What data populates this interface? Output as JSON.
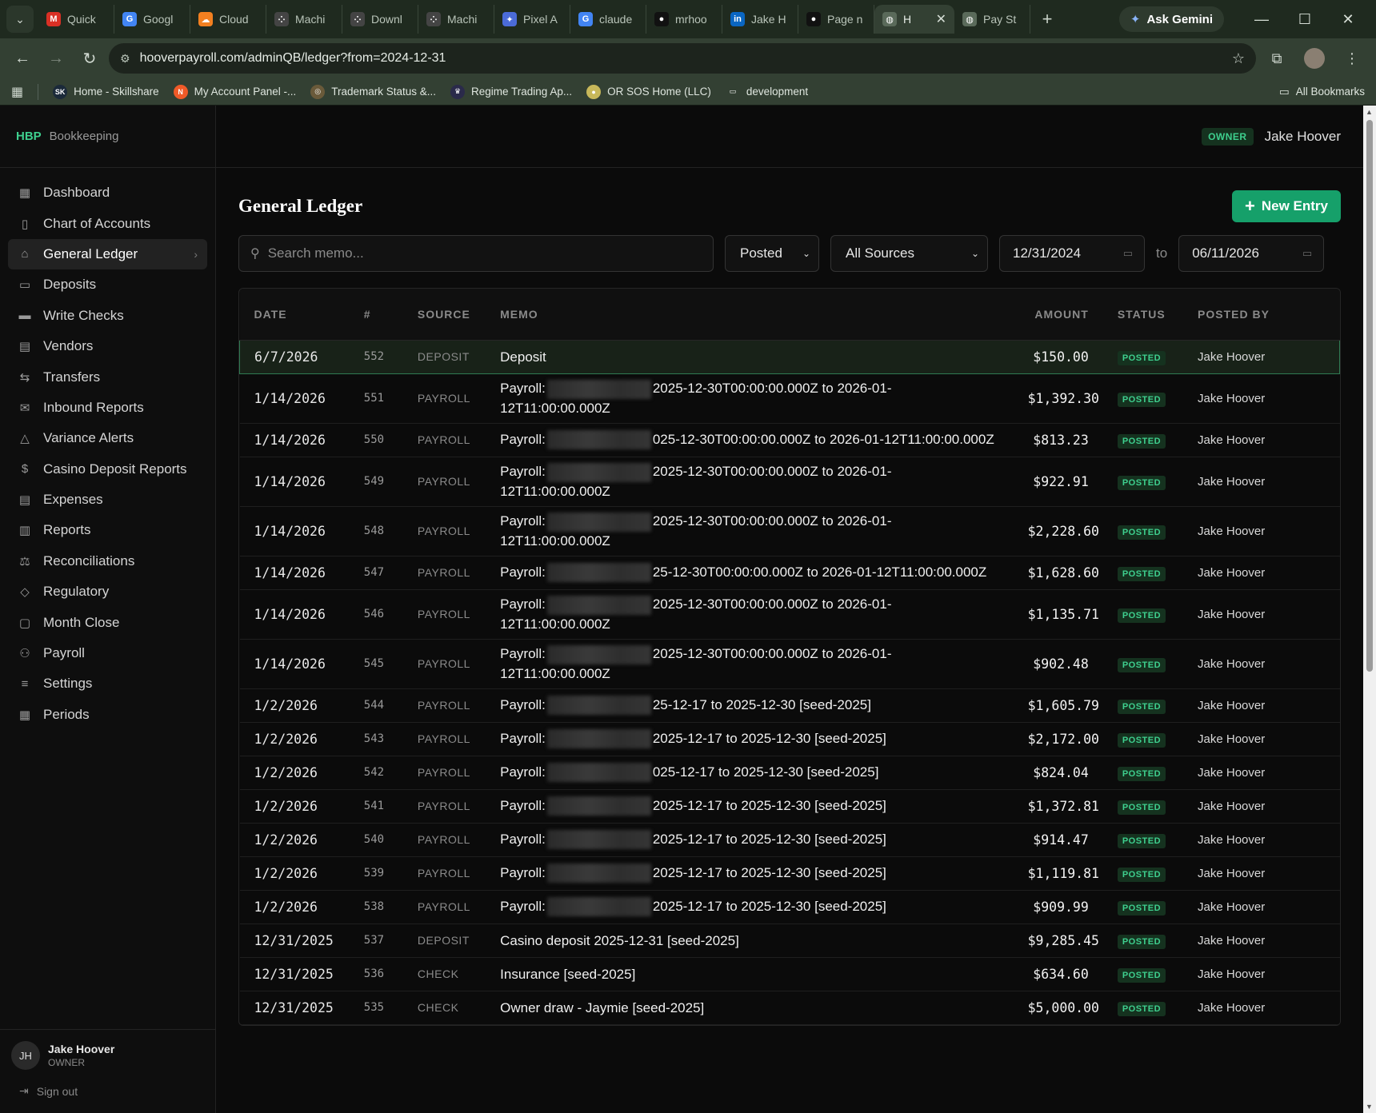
{
  "browser": {
    "tabs": [
      {
        "label": "Quick",
        "icon": "gmail-icon",
        "color": "#d93025",
        "glyph": "M"
      },
      {
        "label": "Googl",
        "icon": "google-icon",
        "color": "#4285f4",
        "glyph": "G"
      },
      {
        "label": "Cloud",
        "icon": "cloudflare-icon",
        "color": "#f38020",
        "glyph": "☁"
      },
      {
        "label": "Machi",
        "icon": "dots-icon",
        "color": "#444444",
        "glyph": "⁘"
      },
      {
        "label": "Downl",
        "icon": "dots-icon",
        "color": "#444444",
        "glyph": "⁘"
      },
      {
        "label": "Machi",
        "icon": "dots-icon",
        "color": "#444444",
        "glyph": "⁘"
      },
      {
        "label": "Pixel A",
        "icon": "gemini-icon",
        "color": "#4b6bd8",
        "glyph": "✦"
      },
      {
        "label": "claude",
        "icon": "google-icon",
        "color": "#4285f4",
        "glyph": "G"
      },
      {
        "label": "mrhoo",
        "icon": "github-icon",
        "color": "#111111",
        "glyph": "●"
      },
      {
        "label": "Jake H",
        "icon": "linkedin-icon",
        "color": "#0a66c2",
        "glyph": "in"
      },
      {
        "label": "Page n",
        "icon": "github-icon",
        "color": "#111111",
        "glyph": "●"
      }
    ],
    "active_tab": {
      "label": "H",
      "icon": "globe-icon"
    },
    "after_tab": {
      "label": "Pay St",
      "icon": "globe-icon"
    },
    "gemini_label": "Ask Gemini",
    "url": "hooverpayroll.com/adminQB/ledger?from=2024-12-31",
    "bookmarks": [
      {
        "label": "Home - Skillshare",
        "glyph": "SK",
        "color": "#1b2a3a"
      },
      {
        "label": "My Account Panel -...",
        "glyph": "N",
        "color": "#f05a28"
      },
      {
        "label": "Trademark Status &...",
        "glyph": "◎",
        "color": "#6a5a3a"
      },
      {
        "label": "Regime Trading Ap...",
        "glyph": "♛",
        "color": "#2a2a4a"
      },
      {
        "label": "OR SOS Home (LLC)",
        "glyph": "●",
        "color": "#c8b85a"
      },
      {
        "label": "development",
        "glyph": "▭",
        "color": "transparent"
      }
    ],
    "all_bookmarks": "All Bookmarks"
  },
  "app": {
    "brand_mark": "HBP",
    "brand_name": "Bookkeeping",
    "nav": [
      {
        "label": "Dashboard",
        "icon": "▦",
        "name": "dashboard"
      },
      {
        "label": "Chart of Accounts",
        "icon": "▯",
        "name": "chart-of-accounts"
      },
      {
        "label": "General Ledger",
        "icon": "⌂",
        "name": "general-ledger",
        "active": true
      },
      {
        "label": "Deposits",
        "icon": "▭",
        "name": "deposits"
      },
      {
        "label": "Write Checks",
        "icon": "▬",
        "name": "write-checks"
      },
      {
        "label": "Vendors",
        "icon": "▤",
        "name": "vendors"
      },
      {
        "label": "Transfers",
        "icon": "⇆",
        "name": "transfers"
      },
      {
        "label": "Inbound Reports",
        "icon": "✉",
        "name": "inbound-reports"
      },
      {
        "label": "Variance Alerts",
        "icon": "△",
        "name": "variance-alerts"
      },
      {
        "label": "Casino Deposit Reports",
        "icon": "$",
        "name": "casino-deposit-reports"
      },
      {
        "label": "Expenses",
        "icon": "▤",
        "name": "expenses"
      },
      {
        "label": "Reports",
        "icon": "▥",
        "name": "reports"
      },
      {
        "label": "Reconciliations",
        "icon": "⚖",
        "name": "reconciliations"
      },
      {
        "label": "Regulatory",
        "icon": "◇",
        "name": "regulatory"
      },
      {
        "label": "Month Close",
        "icon": "▢",
        "name": "month-close"
      },
      {
        "label": "Payroll",
        "icon": "⚇",
        "name": "payroll"
      },
      {
        "label": "Settings",
        "icon": "≡",
        "name": "settings"
      },
      {
        "label": "Periods",
        "icon": "▦",
        "name": "periods"
      }
    ],
    "user": {
      "initials": "JH",
      "name": "Jake Hoover",
      "role": "OWNER"
    },
    "sign_out": "Sign out",
    "topbar": {
      "role_badge": "OWNER",
      "user_name": "Jake Hoover"
    },
    "page_title": "General Ledger",
    "new_entry_label": "New Entry",
    "filters": {
      "search_placeholder": "Search memo...",
      "status_value": "Posted",
      "source_value": "All Sources",
      "from_date": "12/31/2024",
      "to_label": "to",
      "to_date": "06/11/2026"
    },
    "columns": [
      "DATE",
      "#",
      "SOURCE",
      "MEMO",
      "AMOUNT",
      "STATUS",
      "POSTED BY"
    ],
    "rows": [
      {
        "date": "6/7/2026",
        "num": "552",
        "source": "DEPOSIT",
        "memo_a": "Deposit",
        "redacted": false,
        "memo_b": "",
        "amount": "$150.00",
        "status": "POSTED",
        "by": "Jake Hoover",
        "selected": true
      },
      {
        "date": "1/14/2026",
        "num": "551",
        "source": "PAYROLL",
        "memo_a": "Payroll:",
        "redacted": true,
        "memo_b": "2025-12-30T00:00:00.000Z to 2026-01-12T11:00:00.000Z",
        "amount": "$1,392.30",
        "status": "POSTED",
        "by": "Jake Hoover"
      },
      {
        "date": "1/14/2026",
        "num": "550",
        "source": "PAYROLL",
        "memo_a": "Payroll:",
        "redacted": true,
        "memo_b": "025-12-30T00:00:00.000Z to 2026-01-12T11:00:00.000Z",
        "amount": "$813.23",
        "status": "POSTED",
        "by": "Jake Hoover"
      },
      {
        "date": "1/14/2026",
        "num": "549",
        "source": "PAYROLL",
        "memo_a": "Payroll:",
        "redacted": true,
        "memo_b": "2025-12-30T00:00:00.000Z to 2026-01-12T11:00:00.000Z",
        "amount": "$922.91",
        "status": "POSTED",
        "by": "Jake Hoover"
      },
      {
        "date": "1/14/2026",
        "num": "548",
        "source": "PAYROLL",
        "memo_a": "Payroll:",
        "redacted": true,
        "memo_b": "2025-12-30T00:00:00.000Z to 2026-01-12T11:00:00.000Z",
        "amount": "$2,228.60",
        "status": "POSTED",
        "by": "Jake Hoover"
      },
      {
        "date": "1/14/2026",
        "num": "547",
        "source": "PAYROLL",
        "memo_a": "Payroll:",
        "redacted": true,
        "memo_b": "25-12-30T00:00:00.000Z to 2026-01-12T11:00:00.000Z",
        "amount": "$1,628.60",
        "status": "POSTED",
        "by": "Jake Hoover"
      },
      {
        "date": "1/14/2026",
        "num": "546",
        "source": "PAYROLL",
        "memo_a": "Payroll:",
        "redacted": true,
        "memo_b": "2025-12-30T00:00:00.000Z to 2026-01-12T11:00:00.000Z",
        "amount": "$1,135.71",
        "status": "POSTED",
        "by": "Jake Hoover"
      },
      {
        "date": "1/14/2026",
        "num": "545",
        "source": "PAYROLL",
        "memo_a": "Payroll:",
        "redacted": true,
        "memo_b": "2025-12-30T00:00:00.000Z to 2026-01-12T11:00:00.000Z",
        "amount": "$902.48",
        "status": "POSTED",
        "by": "Jake Hoover"
      },
      {
        "date": "1/2/2026",
        "num": "544",
        "source": "PAYROLL",
        "memo_a": "Payroll:",
        "redacted": true,
        "memo_b": "25-12-17 to 2025-12-30 [seed-2025]",
        "amount": "$1,605.79",
        "status": "POSTED",
        "by": "Jake Hoover"
      },
      {
        "date": "1/2/2026",
        "num": "543",
        "source": "PAYROLL",
        "memo_a": "Payroll:",
        "redacted": true,
        "memo_b": "2025-12-17 to 2025-12-30 [seed-2025]",
        "amount": "$2,172.00",
        "status": "POSTED",
        "by": "Jake Hoover"
      },
      {
        "date": "1/2/2026",
        "num": "542",
        "source": "PAYROLL",
        "memo_a": "Payroll:",
        "redacted": true,
        "memo_b": "025-12-17 to 2025-12-30 [seed-2025]",
        "amount": "$824.04",
        "status": "POSTED",
        "by": "Jake Hoover"
      },
      {
        "date": "1/2/2026",
        "num": "541",
        "source": "PAYROLL",
        "memo_a": "Payroll:",
        "redacted": true,
        "memo_b": "2025-12-17 to 2025-12-30 [seed-2025]",
        "amount": "$1,372.81",
        "status": "POSTED",
        "by": "Jake Hoover"
      },
      {
        "date": "1/2/2026",
        "num": "540",
        "source": "PAYROLL",
        "memo_a": "Payroll:",
        "redacted": true,
        "memo_b": "2025-12-17 to 2025-12-30 [seed-2025]",
        "amount": "$914.47",
        "status": "POSTED",
        "by": "Jake Hoover"
      },
      {
        "date": "1/2/2026",
        "num": "539",
        "source": "PAYROLL",
        "memo_a": "Payroll:",
        "redacted": true,
        "memo_b": "2025-12-17 to 2025-12-30 [seed-2025]",
        "amount": "$1,119.81",
        "status": "POSTED",
        "by": "Jake Hoover"
      },
      {
        "date": "1/2/2026",
        "num": "538",
        "source": "PAYROLL",
        "memo_a": "Payroll:",
        "redacted": true,
        "memo_b": "2025-12-17 to 2025-12-30 [seed-2025]",
        "amount": "$909.99",
        "status": "POSTED",
        "by": "Jake Hoover"
      },
      {
        "date": "12/31/2025",
        "num": "537",
        "source": "DEPOSIT",
        "memo_a": "Casino deposit 2025-12-31 [seed-2025]",
        "redacted": false,
        "memo_b": "",
        "amount": "$9,285.45",
        "status": "POSTED",
        "by": "Jake Hoover"
      },
      {
        "date": "12/31/2025",
        "num": "536",
        "source": "CHECK",
        "memo_a": "Insurance [seed-2025]",
        "redacted": false,
        "memo_b": "",
        "amount": "$634.60",
        "status": "POSTED",
        "by": "Jake Hoover"
      },
      {
        "date": "12/31/2025",
        "num": "535",
        "source": "CHECK",
        "memo_a": "Owner draw - Jaymie [seed-2025]",
        "redacted": false,
        "memo_b": "",
        "amount": "$5,000.00",
        "status": "POSTED",
        "by": "Jake Hoover"
      }
    ]
  }
}
